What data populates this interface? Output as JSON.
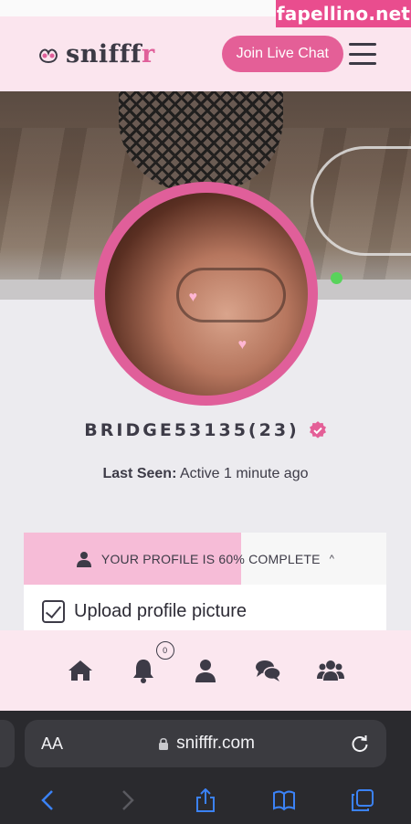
{
  "watermark": {
    "text": "fapellino.net"
  },
  "header": {
    "logo_text_main": "snifff",
    "logo_text_accent": "r",
    "join_button": "Join Live Chat"
  },
  "profile": {
    "username": "BRIDGE53135(23)",
    "last_seen_label": "Last Seen:",
    "last_seen_value": "Active 1 minute ago",
    "online": true
  },
  "completion": {
    "text": "YOUR PROFILE IS 60% COMPLETE",
    "percent": 60,
    "task": "Upload profile picture"
  },
  "bottom_nav": {
    "notification_count": "0",
    "items": [
      "home",
      "notifications",
      "profile",
      "chat",
      "groups"
    ]
  },
  "browser": {
    "text_size_label": "AA",
    "url": "snifffr.com"
  },
  "colors": {
    "accent": "#e45f97",
    "header_bg": "#fbe5ee",
    "progress_fill": "#f6bcd7",
    "online": "#58d35b",
    "ios_blue": "#3b82f6"
  }
}
